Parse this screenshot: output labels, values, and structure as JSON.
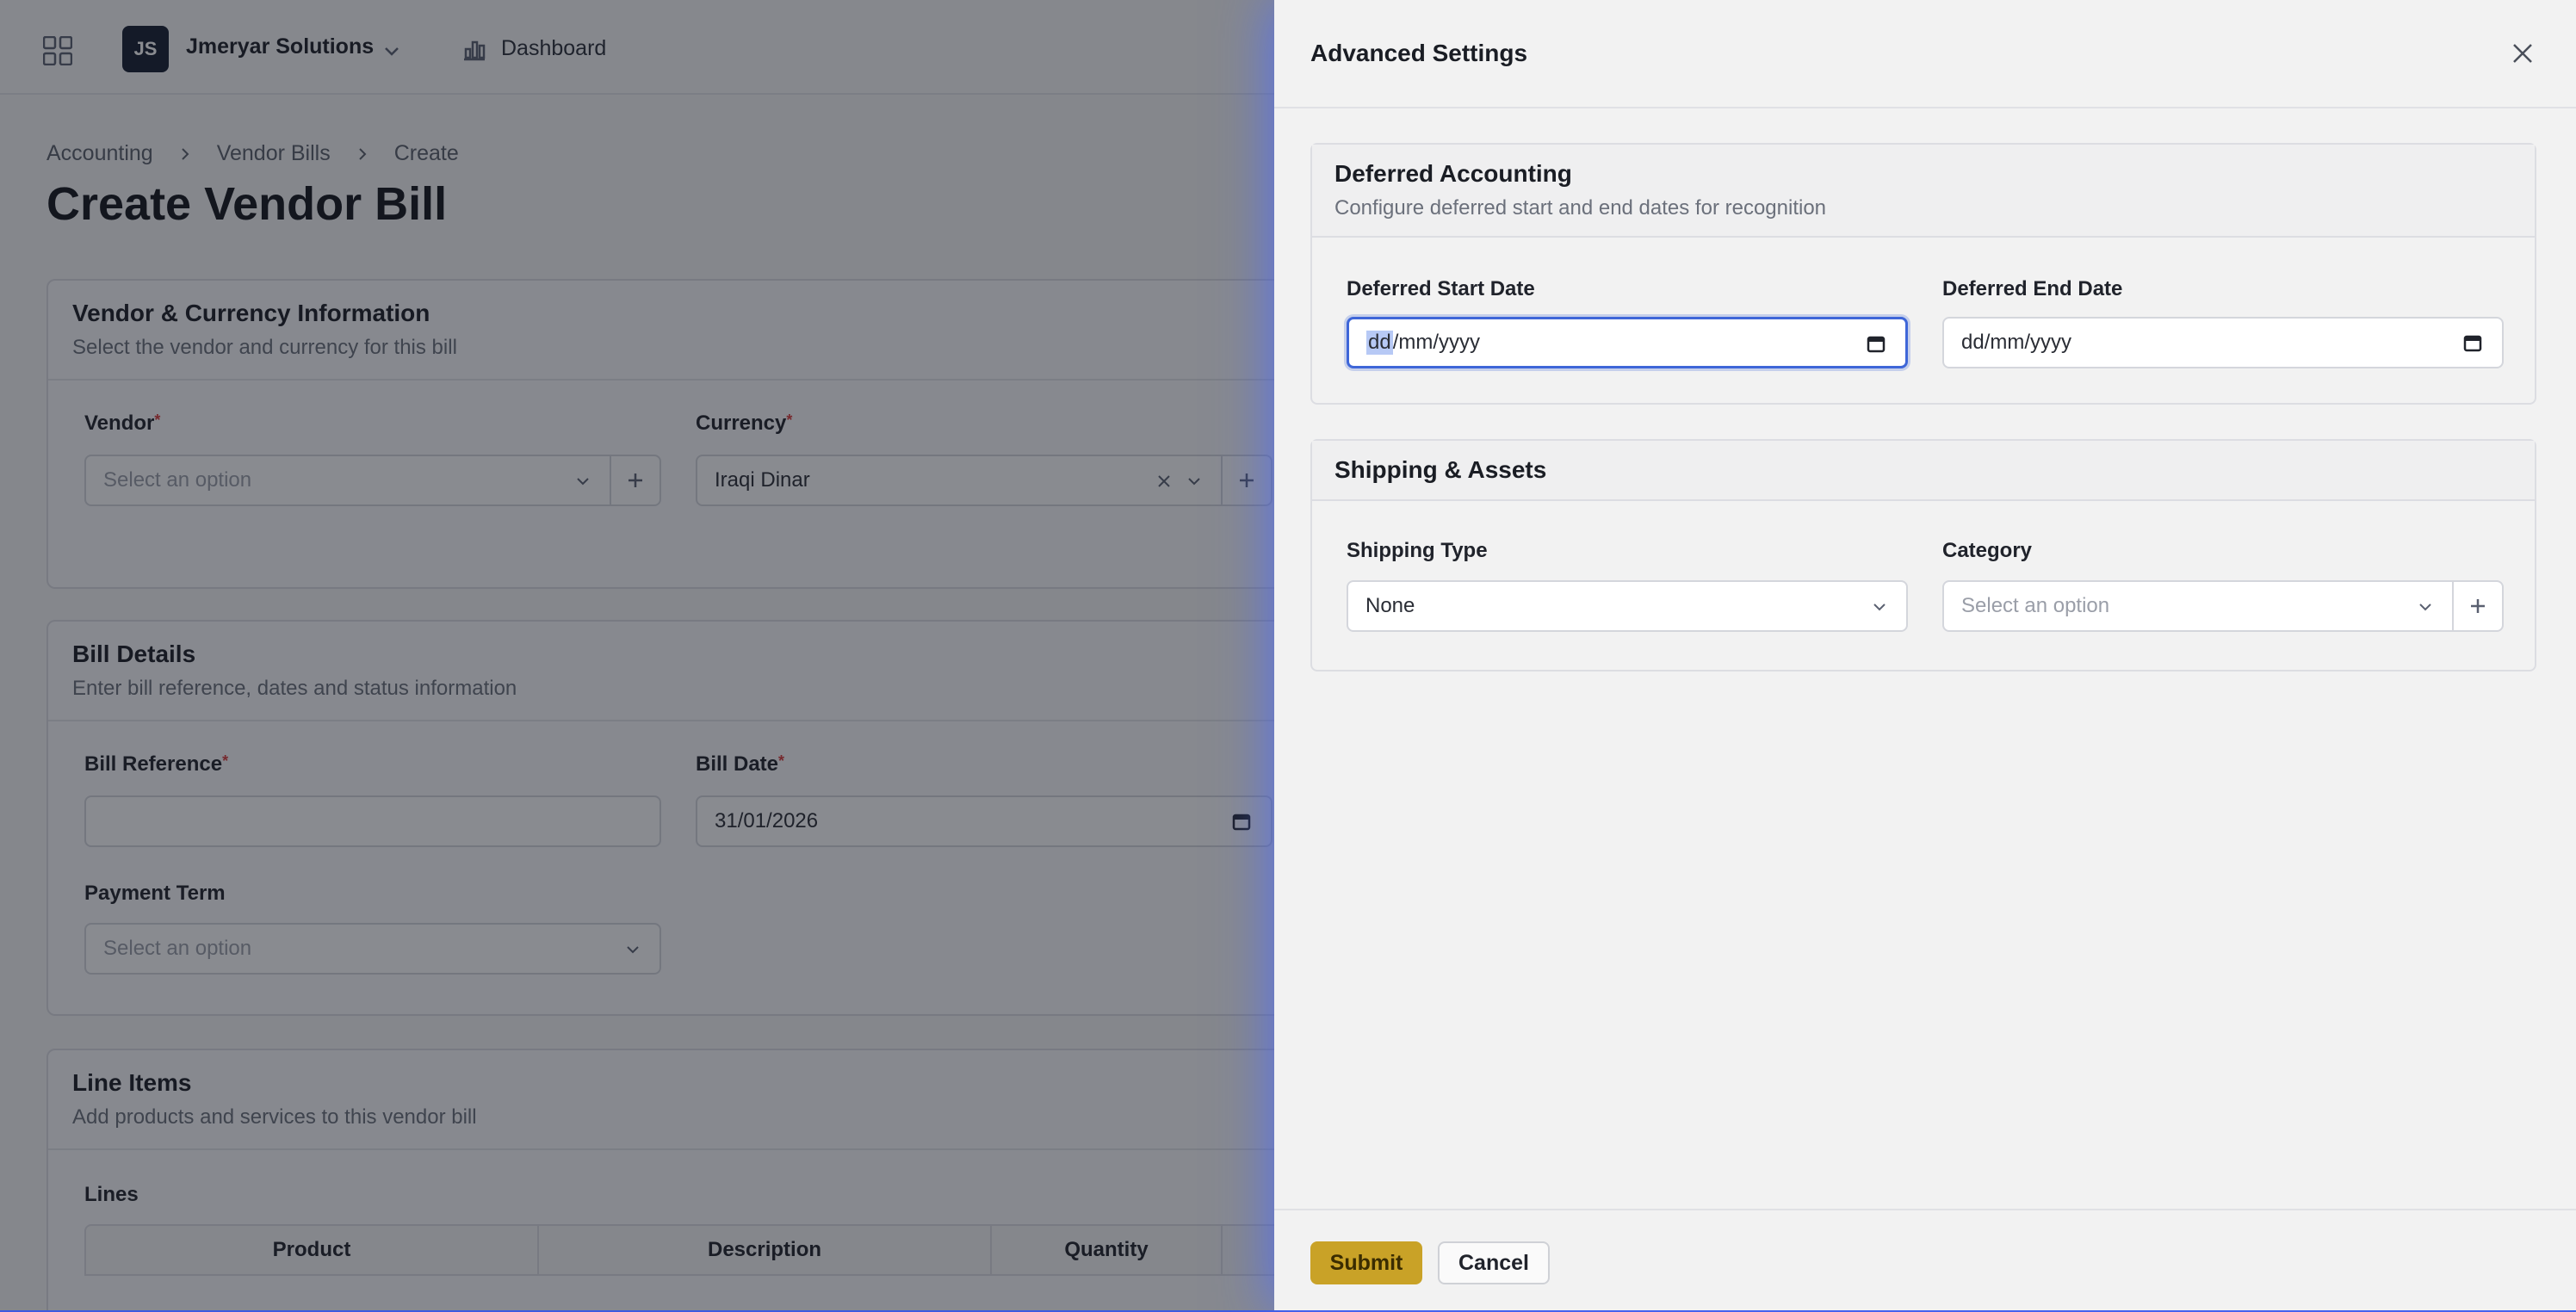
{
  "topbar": {
    "org_initials": "JS",
    "org_name": "Jmeryar Solutions",
    "dashboard_label": "Dashboard"
  },
  "breadcrumb": [
    "Accounting",
    "Vendor Bills",
    "Create"
  ],
  "page_title": "Create Vendor Bill",
  "vendor_section": {
    "title": "Vendor & Currency Information",
    "subtitle": "Select the vendor and currency for this bill",
    "vendor_label": "Vendor",
    "vendor_placeholder": "Select an option",
    "currency_label": "Currency",
    "currency_value": "Iraqi Dinar"
  },
  "bill_section": {
    "title": "Bill Details",
    "subtitle": "Enter bill reference, dates and status information",
    "reference_label": "Bill Reference",
    "date_label": "Bill Date",
    "date_value": "31/01/2026",
    "payment_term_label": "Payment Term",
    "payment_term_placeholder": "Select an option"
  },
  "lines_section": {
    "title": "Line Items",
    "subtitle": "Add products and services to this vendor bill",
    "lines_label": "Lines",
    "columns": [
      "Product",
      "Description",
      "Quantity"
    ]
  },
  "drawer": {
    "title": "Advanced Settings",
    "deferred": {
      "title": "Deferred Accounting",
      "subtitle": "Configure deferred start and end dates for recognition",
      "start_label": "Deferred Start Date",
      "start_dd": "dd",
      "start_rest": "/mm/yyyy",
      "end_label": "Deferred End Date",
      "end_value": "dd/mm/yyyy"
    },
    "shipping": {
      "title": "Shipping & Assets",
      "type_label": "Shipping Type",
      "type_value": "None",
      "category_label": "Category",
      "category_placeholder": "Select an option"
    },
    "submit_label": "Submit",
    "cancel_label": "Cancel"
  },
  "colors": {
    "accent_submit": "#c9a227",
    "focus_ring": "#3e66d8",
    "required": "#d83a3a"
  }
}
